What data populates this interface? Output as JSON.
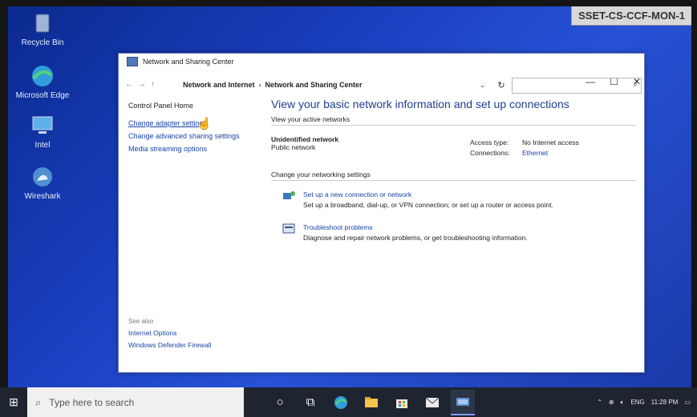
{
  "sticker": "SSET-CS-CCF-MON-1",
  "desktop_icons": [
    {
      "label": "Recycle Bin",
      "icon": "recycle-bin-icon"
    },
    {
      "label": "Microsoft Edge",
      "icon": "edge-icon"
    },
    {
      "label": "Intel",
      "icon": "computer-icon"
    },
    {
      "label": "Wireshark",
      "icon": "shark-fin-icon"
    }
  ],
  "window": {
    "title": "Network and Sharing Center",
    "nav": {
      "back": "←",
      "forward": "→",
      "up": "↑"
    },
    "breadcrumb": [
      "Network and Internet",
      "Network and Sharing Center"
    ],
    "breadcrumb_sep": "›",
    "controls": {
      "minimize": "—",
      "maximize": "☐",
      "close": "✕"
    },
    "refresh": "↻",
    "dropdown": "⌄",
    "search_placeholder": ""
  },
  "left_panel": {
    "home": "Control Panel Home",
    "links": [
      "Change adapter settings",
      "Change advanced sharing settings",
      "Media streaming options"
    ],
    "see_also_title": "See also",
    "see_also": [
      "Internet Options",
      "Windows Defender Firewall"
    ]
  },
  "main": {
    "heading": "View your basic network information and set up connections",
    "active_networks_title": "View your active networks",
    "network": {
      "name": "Unidentified network",
      "type": "Public network",
      "access_type_label": "Access type:",
      "access_type_value": "No Internet access",
      "connections_label": "Connections:",
      "connections_value": "Ethernet"
    },
    "change_title": "Change your networking settings",
    "tasks": [
      {
        "title": "Set up a new connection or network",
        "desc": "Set up a broadband, dial-up, or VPN connection; or set up a router or access point."
      },
      {
        "title": "Troubleshoot problems",
        "desc": "Diagnose and repair network problems, or get troubleshooting information."
      }
    ]
  },
  "taskbar": {
    "search_placeholder": "Type here to search",
    "tray_lang": "ENG",
    "tray_time": "11:28 PM"
  }
}
